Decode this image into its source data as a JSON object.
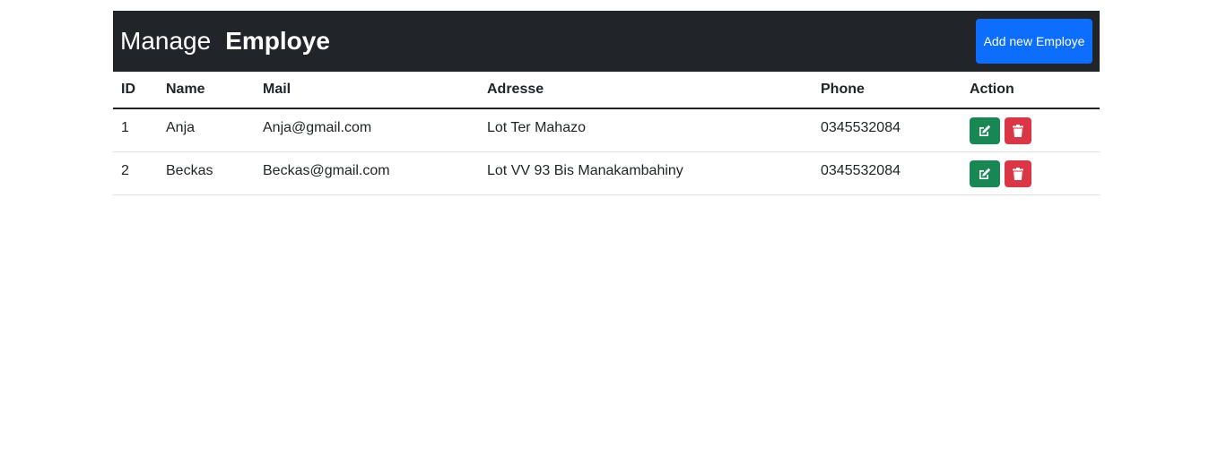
{
  "header": {
    "title_prefix": "Manage",
    "title_strong": "Employe",
    "add_button": "Add new Employe"
  },
  "table": {
    "columns": [
      "ID",
      "Name",
      "Mail",
      "Adresse",
      "Phone",
      "Action"
    ],
    "rows": [
      {
        "id": "1",
        "name": "Anja",
        "mail": "Anja@gmail.com",
        "adresse": "Lot Ter Mahazo",
        "phone": "0345532084"
      },
      {
        "id": "2",
        "name": "Beckas",
        "mail": "Beckas@gmail.com",
        "adresse": "Lot VV 93 Bis Manakambahiny",
        "phone": "0345532084"
      }
    ],
    "actions": {
      "edit_icon": "edit-icon",
      "delete_icon": "trash-icon"
    }
  },
  "colors": {
    "header_bg": "#212529",
    "primary": "#0d6efd",
    "success": "#198754",
    "danger": "#dc3545"
  }
}
